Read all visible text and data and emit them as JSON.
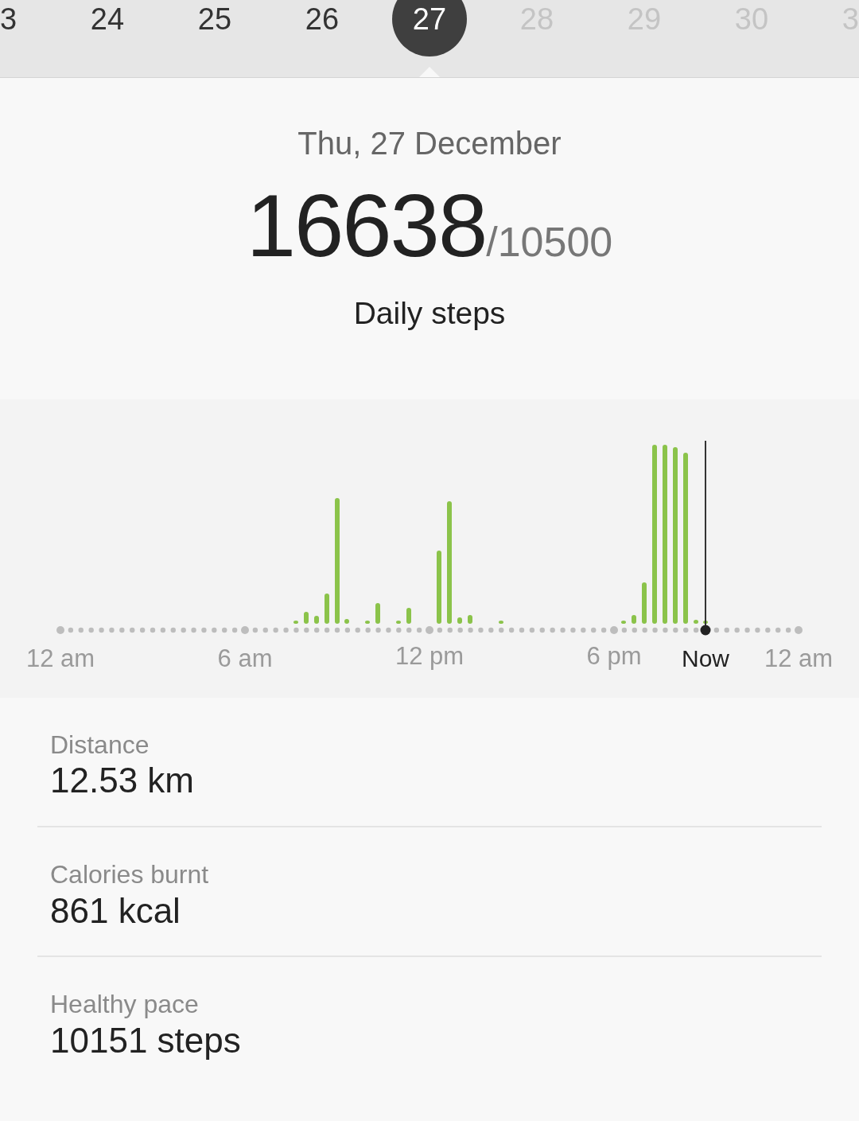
{
  "date_strip": [
    {
      "label": "3",
      "selected": false,
      "disabled": false
    },
    {
      "label": "24",
      "selected": false,
      "disabled": false
    },
    {
      "label": "25",
      "selected": false,
      "disabled": false
    },
    {
      "label": "26",
      "selected": false,
      "disabled": false
    },
    {
      "label": "27",
      "selected": true,
      "disabled": false
    },
    {
      "label": "28",
      "selected": false,
      "disabled": true
    },
    {
      "label": "29",
      "selected": false,
      "disabled": true
    },
    {
      "label": "30",
      "selected": false,
      "disabled": true
    },
    {
      "label": "3",
      "selected": false,
      "disabled": true
    }
  ],
  "summary": {
    "date": "Thu, 27 December",
    "steps": "16638",
    "goal": "/10500",
    "caption": "Daily steps"
  },
  "chart": {
    "axis_labels": [
      {
        "label": "12 am",
        "kind": "tick"
      },
      {
        "label": "6 am",
        "kind": "tick"
      },
      {
        "label": "12 pm",
        "kind": "tick"
      },
      {
        "label": "6 pm",
        "kind": "tick"
      },
      {
        "label": "Now",
        "kind": "now"
      },
      {
        "label": "12 am",
        "kind": "tick"
      }
    ]
  },
  "stats": [
    {
      "label": "Distance",
      "value": "12.53 km"
    },
    {
      "label": "Calories burnt",
      "value": "861 kcal"
    },
    {
      "label": "Healthy pace",
      "value": "10151 steps"
    }
  ]
}
